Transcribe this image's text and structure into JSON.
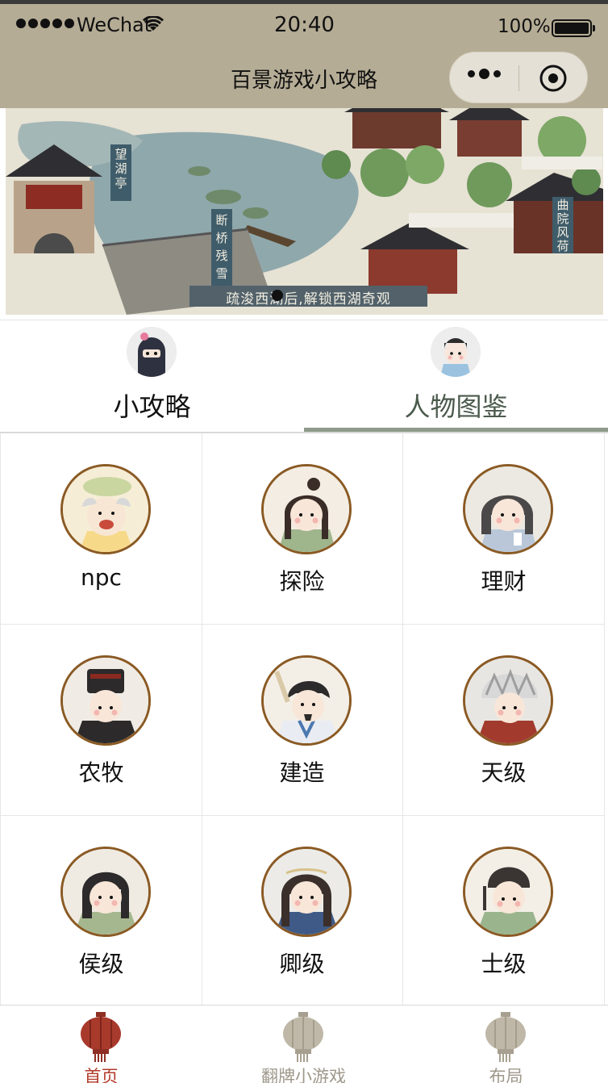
{
  "status_bar": {
    "carrier": "WeChat",
    "time": "20:40",
    "battery": "100%"
  },
  "nav": {
    "title": "百景游戏小攻略"
  },
  "colors": {
    "nav_bg": "#b5ac95",
    "active_tab": "#4b5a4c",
    "tabbar_active": "#b23a2a",
    "tabbar_inactive": "#9e978a",
    "portrait_ring": "#8a5a24"
  },
  "banner": {
    "caption": "疏浚西湖后,解锁西湖奇观",
    "signs": [
      "望湖亭",
      "断桥残雪",
      "曲院风荷"
    ],
    "active_dot": 1
  },
  "tabs": [
    {
      "label": "小攻略",
      "icon": "ninja-avatar-icon",
      "active": false
    },
    {
      "label": "人物图鉴",
      "icon": "scholar-avatar-icon",
      "active": true
    }
  ],
  "grid": [
    {
      "label": "npc"
    },
    {
      "label": "探险"
    },
    {
      "label": "理财"
    },
    {
      "label": "农牧"
    },
    {
      "label": "建造"
    },
    {
      "label": "天级"
    },
    {
      "label": "侯级"
    },
    {
      "label": "卿级"
    },
    {
      "label": "士级"
    }
  ],
  "tabbar": [
    {
      "label": "首页",
      "icon": "lantern-icon",
      "active": true
    },
    {
      "label": "翻牌小游戏",
      "icon": "lantern-icon",
      "active": false
    },
    {
      "label": "布局",
      "icon": "lantern-icon",
      "active": false
    }
  ]
}
